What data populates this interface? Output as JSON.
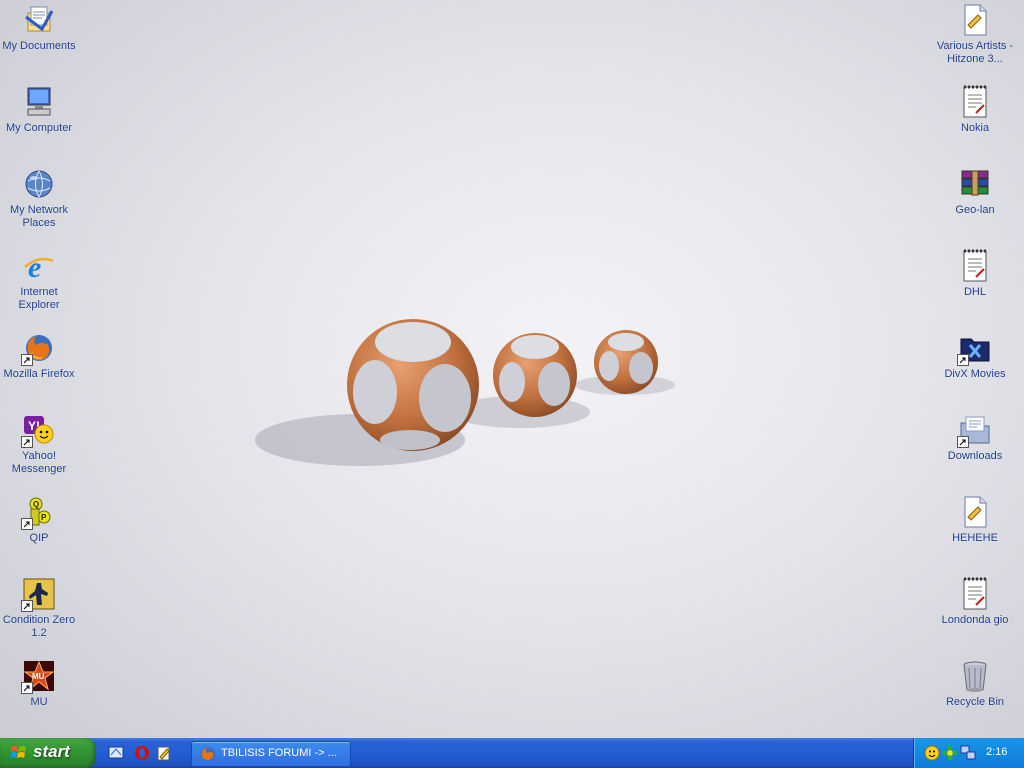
{
  "desktop": {
    "left_icons": [
      {
        "label": "My Documents",
        "icon": "my-documents-icon"
      },
      {
        "label": "My Computer",
        "icon": "my-computer-icon"
      },
      {
        "label": "My Network Places",
        "icon": "network-places-icon"
      },
      {
        "label": "Internet Explorer",
        "icon": "internet-explorer-icon"
      },
      {
        "label": "Mozilla Firefox",
        "icon": "firefox-icon",
        "shortcut": true
      },
      {
        "label": "Yahoo! Messenger",
        "icon": "yahoo-messenger-icon",
        "shortcut": true
      },
      {
        "label": "QIP",
        "icon": "qip-icon",
        "shortcut": true
      },
      {
        "label": "Condition Zero 1.2",
        "icon": "condition-zero-icon",
        "shortcut": true
      },
      {
        "label": "MU",
        "icon": "mu-icon",
        "shortcut": true
      }
    ],
    "right_icons": [
      {
        "label": "Various Artists - Hitzone 3...",
        "icon": "text-document-icon"
      },
      {
        "label": "Nokia",
        "icon": "wordpad-document-icon"
      },
      {
        "label": "Geo-lan",
        "icon": "winrar-archive-icon"
      },
      {
        "label": "DHL",
        "icon": "wordpad-document-icon"
      },
      {
        "label": "DivX Movies",
        "icon": "divx-folder-icon",
        "shortcut": true
      },
      {
        "label": "Downloads",
        "icon": "downloads-folder-icon",
        "shortcut": true
      },
      {
        "label": "HEHEHE",
        "icon": "text-document-icon"
      },
      {
        "label": "Londonda gio",
        "icon": "wordpad-document-icon"
      },
      {
        "label": "Recycle Bin",
        "icon": "recycle-bin-icon"
      }
    ]
  },
  "taskbar": {
    "start_label": "start",
    "quick_launch": [
      "show-desktop-icon",
      "opera-icon",
      "notepad-icon"
    ],
    "task": {
      "label": "TBILISIS FORUMI -> ...",
      "icon": "firefox-icon"
    },
    "tray": {
      "icons": [
        "yahoo-tray-icon",
        "qip-tray-icon",
        "network-tray-icon"
      ],
      "clock": "2:16"
    }
  },
  "colors": {
    "taskbar_blue": "#245ed3",
    "start_green": "#3c9e3c",
    "tray_blue": "#1896e8",
    "icon_label": "#1a3a8a"
  }
}
